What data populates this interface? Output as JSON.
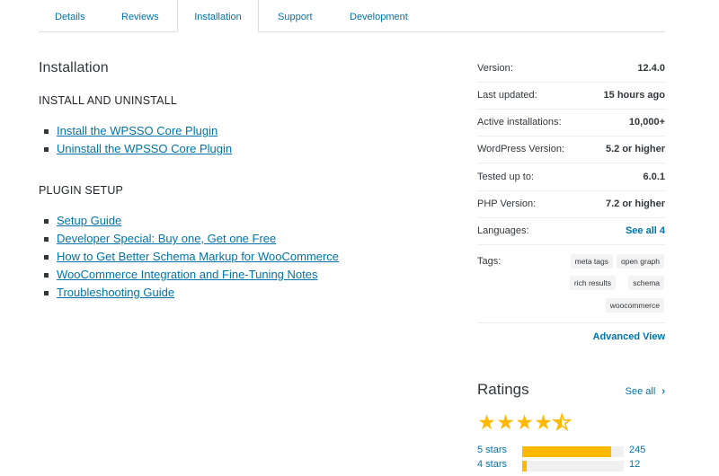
{
  "tabs": [
    {
      "label": "Details",
      "active": false
    },
    {
      "label": "Reviews",
      "active": false
    },
    {
      "label": "Installation",
      "active": true
    },
    {
      "label": "Support",
      "active": false
    },
    {
      "label": "Development",
      "active": false
    }
  ],
  "main": {
    "title": "Installation",
    "sections": [
      {
        "heading": "INSTALL AND UNINSTALL",
        "links": [
          "Install the WPSSO Core Plugin",
          "Uninstall the WPSSO Core Plugin"
        ]
      },
      {
        "heading": "PLUGIN SETUP",
        "links": [
          "Setup Guide",
          "Developer Special: Buy one, Get one Free",
          "How to Get Better Schema Markup for WooCommerce",
          "WooCommerce Integration and Fine-Tuning Notes",
          "Troubleshooting Guide"
        ]
      }
    ]
  },
  "meta": [
    {
      "key": "Version:",
      "value": "12.4.0"
    },
    {
      "key": "Last updated:",
      "value": "15 hours ago"
    },
    {
      "key": "Active installations:",
      "value": "10,000+"
    },
    {
      "key": "WordPress Version:",
      "value": "5.2 or higher"
    },
    {
      "key": "Tested up to:",
      "value": "6.0.1"
    },
    {
      "key": "PHP Version:",
      "value": "7.2 or higher"
    },
    {
      "key": "Languages:",
      "value": "See all 4"
    }
  ],
  "tags": {
    "label": "Tags:",
    "items": [
      "meta tags",
      "open graph",
      "rich results",
      "schema",
      "woocommerce"
    ]
  },
  "advanced_view": "Advanced View",
  "ratings": {
    "title": "Ratings",
    "see_all": "See all",
    "star_rating": 4.5,
    "bars": [
      {
        "label": "5 stars",
        "count": "245",
        "fraction": 0.88
      },
      {
        "label": "4 stars",
        "count": "12",
        "fraction": 0.04
      }
    ]
  },
  "colors": {
    "link": "#0073aa",
    "star": "#ffb900",
    "text": "#32373c"
  }
}
